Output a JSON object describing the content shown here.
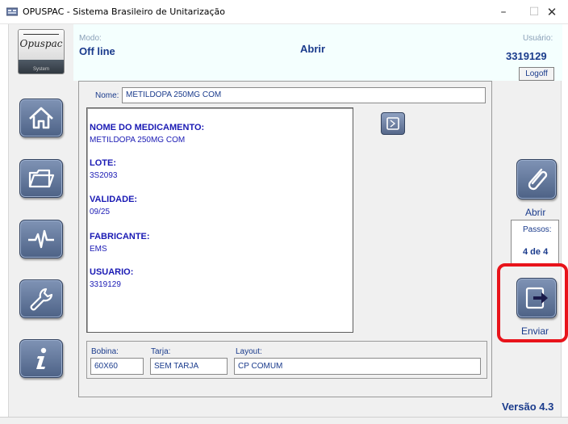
{
  "window": {
    "title": "OPUSPAC - Sistema Brasileiro de Unitarização",
    "min_glyph": "–",
    "max_glyph": "☐",
    "close_glyph": "✕"
  },
  "logo": {
    "text": "Opuspac",
    "subtitle": "System"
  },
  "header": {
    "mode_label": "Modo:",
    "mode_value": "Off line",
    "action_title": "Abrir",
    "user_label": "Usuário:",
    "user_value": "3319129",
    "logoff_label": "Logoff"
  },
  "nav": [
    {
      "icon": "home-icon"
    },
    {
      "icon": "folder-icon"
    },
    {
      "icon": "pulse-icon"
    },
    {
      "icon": "wrench-icon"
    },
    {
      "icon": "info-icon"
    }
  ],
  "form": {
    "name_label": "Nome:",
    "name_value": "METILDOPA 250MG COM",
    "info": [
      {
        "label": "NOME DO MEDICAMENTO:",
        "value": "METILDOPA 250MG COM"
      },
      {
        "label": "LOTE:",
        "value": "3S2093"
      },
      {
        "label": "VALIDADE:",
        "value": "09/25"
      },
      {
        "label": "FABRICANTE:",
        "value": "EMS"
      },
      {
        "label": "USUARIO:",
        "value": "3319129"
      }
    ],
    "bobina_label": "Bobina:",
    "bobina_value": "60X60",
    "tarja_label": "Tarja:",
    "tarja_value": "SEM TARJA",
    "layout_label": "Layout:",
    "layout_value": "CP COMUM"
  },
  "right": {
    "abrir_label": "Abrir",
    "passos_label": "Passos:",
    "passos_value": "4 de 4",
    "enviar_label": "Enviar",
    "version": "Versão 4.3"
  },
  "colors": {
    "accent_text": "#1a3b8c",
    "info_text": "#1a1ab4",
    "highlight": "#e8141b",
    "button_blue": "#5b6f92"
  }
}
